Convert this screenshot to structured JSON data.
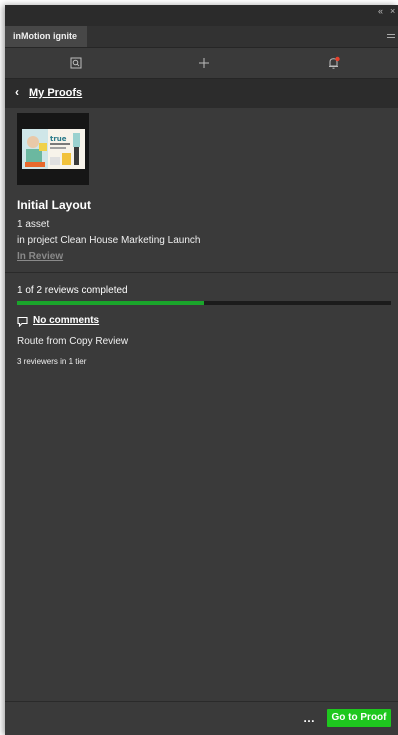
{
  "panel": {
    "tab_title": "inMotion ignite"
  },
  "window": {
    "collapse_glyph": "«",
    "close_glyph": "×"
  },
  "toolbar": {
    "items": [
      {
        "icon": "search-document-icon"
      },
      {
        "icon": "plus-icon"
      },
      {
        "icon": "notification-bell-icon",
        "badge_color": "#e8412c"
      }
    ]
  },
  "nav": {
    "back_glyph": "‹",
    "back_label": "My Proofs"
  },
  "proof": {
    "title": "Initial Layout",
    "asset_count": "1 asset",
    "project_line": "in project Clean House Marketing Launch",
    "status": "In Review",
    "thumbnail_brand": "true"
  },
  "review": {
    "progress_text": "1 of 2 reviews completed",
    "progress_fraction": 0.5,
    "comments_label": "No comments",
    "route_label": "Route from Copy Review",
    "reviewers_label": "3 reviewers in 1 tier"
  },
  "footer": {
    "more_label": "…",
    "goto_label": "Go to Proof"
  },
  "colors": {
    "accent_green": "#1ec71e",
    "progress_green": "#1aa52b",
    "panel_bg": "#3a3a3a",
    "status_gray": "#8a8a8a"
  }
}
